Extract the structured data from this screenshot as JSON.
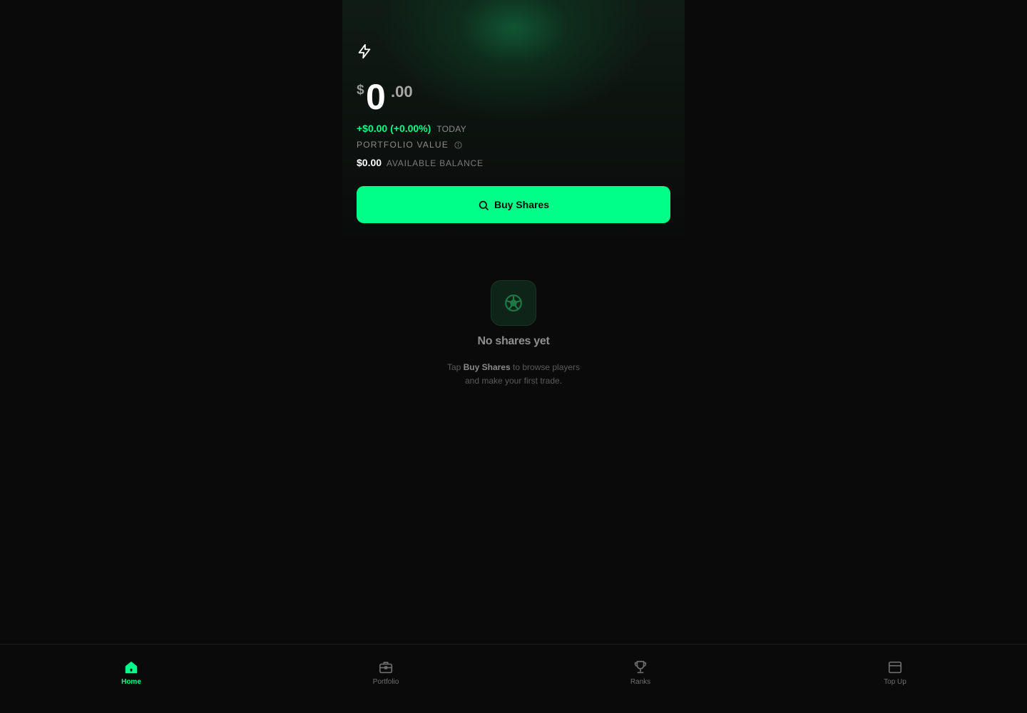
{
  "colors": {
    "accent": "#00ff88",
    "background": "#0a0a0a"
  },
  "hero": {
    "logo_icon": "lightning-bolt-icon",
    "currency": "$",
    "value_int": "0",
    "value_dec": ".00",
    "change": "+$0.00 (+0.00%)",
    "change_period": "TODAY",
    "portfolio_label": "PORTFOLIO VALUE",
    "balance_amount": "$0.00",
    "balance_label": "AVAILABLE BALANCE"
  },
  "buy_button": {
    "label": "Buy Shares",
    "icon": "search-icon"
  },
  "empty_state": {
    "icon": "soccer-ball-icon",
    "title": "No shares yet",
    "desc_prefix": "Tap ",
    "desc_bold": "Buy Shares",
    "desc_line1_suffix": " to browse players",
    "desc_line2": "and make your first trade."
  },
  "nav": {
    "items": [
      {
        "label": "Home",
        "icon": "home-icon",
        "active": true
      },
      {
        "label": "Portfolio",
        "icon": "briefcase-icon",
        "active": false
      },
      {
        "label": "Ranks",
        "icon": "trophy-icon",
        "active": false
      },
      {
        "label": "Top Up",
        "icon": "credit-card-icon",
        "active": false
      }
    ]
  }
}
